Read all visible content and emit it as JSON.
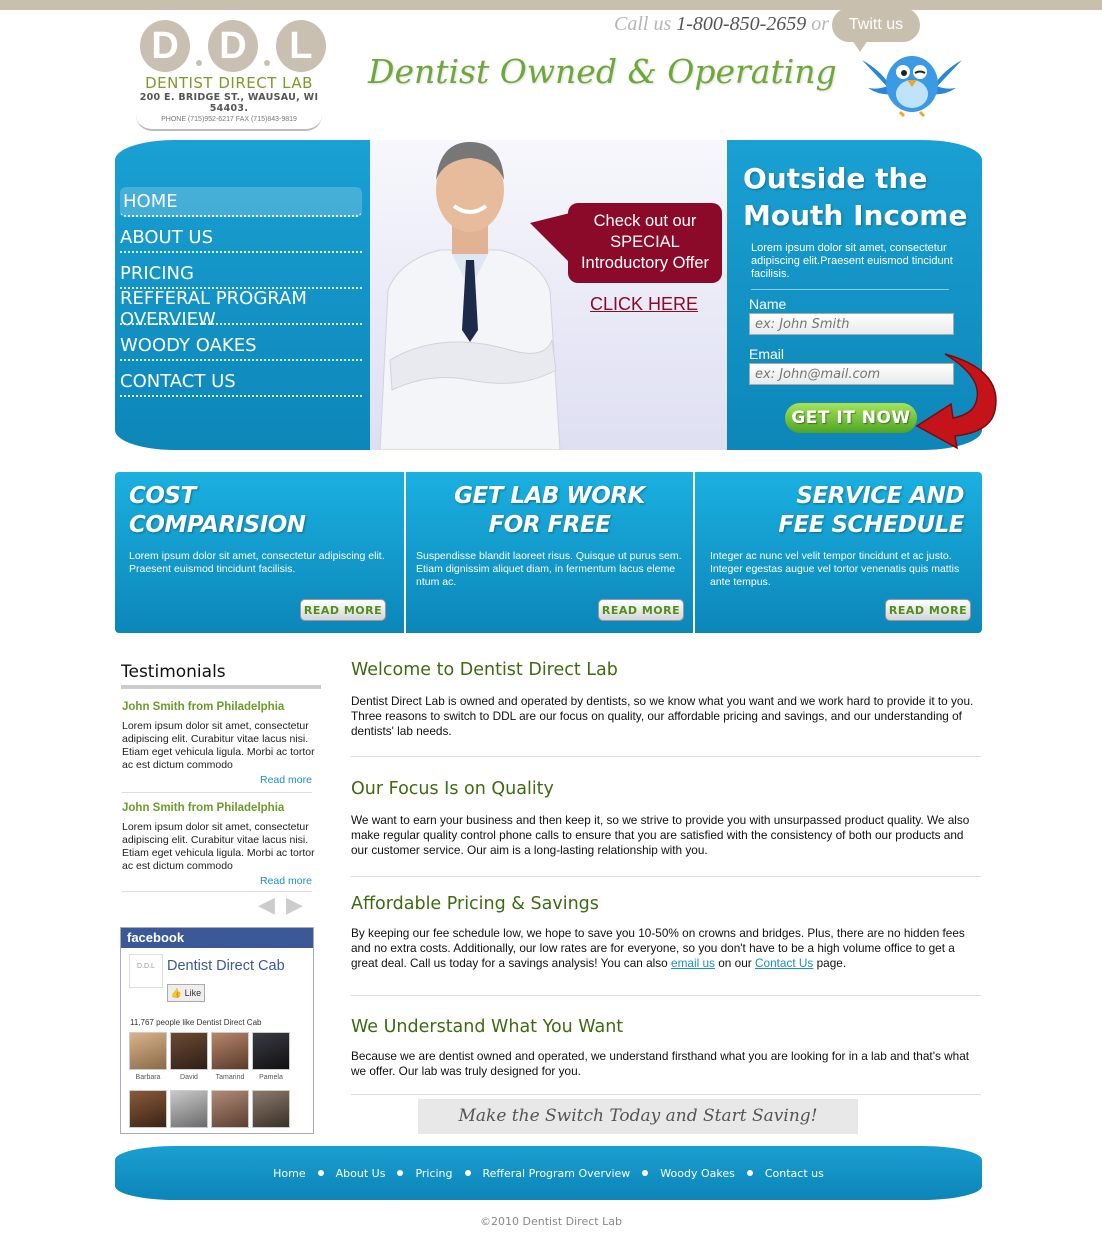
{
  "logo": {
    "letters": [
      "D",
      "D",
      "L"
    ],
    "name": "DENTIST DIRECT LAB",
    "address": "200 E. BRIDGE ST., WAUSAU, WI 54403.",
    "phone": "PHONE (715)952-6217   FAX (715)843-9819"
  },
  "header": {
    "tagline": "Dentist Owned & Operating",
    "call_prefix": "Call us",
    "call_number": "1-800-850-2659",
    "call_suffix": "or",
    "twit_label": "Twitt us"
  },
  "nav": {
    "items": [
      {
        "label": "HOME",
        "active": true
      },
      {
        "label": "ABOUT US"
      },
      {
        "label": "PRICING"
      },
      {
        "label": "REFFERAL PROGRAM OVERVIEW"
      },
      {
        "label": "WOODY OAKES"
      },
      {
        "label": "CONTACT US"
      }
    ]
  },
  "promo": {
    "bubble_line1": "Check out our",
    "bubble_line2": "SPECIAL",
    "bubble_line3": "Introductory Offer",
    "click_here": "CLICK HERE"
  },
  "signup": {
    "title_line1": "Outside the",
    "title_line2": "Mouth Income",
    "text": "Lorem ipsum dolor sit amet, consectetur adipiscing elit.Praesent euismod tincidunt facilisis.",
    "name_label": "Name",
    "name_placeholder": "ex: John Smith",
    "email_label": "Email",
    "email_placeholder": "ex: John@mail.com",
    "button": "GET IT NOW"
  },
  "features": [
    {
      "title_line1": "COST",
      "title_line2": "COMPARISION",
      "text": "Lorem ipsum dolor sit amet, consectetur adipiscing elit. Praesent euismod tincidunt facilisis.",
      "button": "READ MORE"
    },
    {
      "title_line1": "GET LAB WORK",
      "title_line2": "FOR FREE",
      "text": "Suspendisse blandit laoreet risus. Quisque ut purus sem. Etiam dignissim aliquet diam, in fermentum lacus eleme ntum ac.",
      "button": "READ MORE"
    },
    {
      "title_line1": "SERVICE AND",
      "title_line2": "FEE SCHEDULE",
      "text": "Integer ac nunc vel velit tempor tincidunt et ac justo. Integer egestas augue vel tortor venenatis quis mattis ante tempus.",
      "button": "READ MORE"
    }
  ],
  "testimonials": {
    "title": "Testimonials",
    "items": [
      {
        "name": "John Smith from Philadelphia",
        "text": "Lorem ipsum dolor sit amet, consectetur adipiscing elit. Curabitur vitae lacus nisi. Etiam eget vehicula ligula. Morbi ac tortor ac est dictum commodo",
        "more": "Read more"
      },
      {
        "name": "John Smith from Philadelphia",
        "text": "Lorem ipsum dolor sit amet, consectetur adipiscing elit. Curabitur vitae lacus nisi. Etiam eget vehicula ligula. Morbi ac tortor ac est dictum commodo",
        "more": "Read more"
      }
    ]
  },
  "facebook": {
    "header": "facebook",
    "logo_text": "D.D.L",
    "page_name": "Dentist Direct Cab",
    "like": "Like",
    "count_text": "11,767 people like Dentist Direct Cab",
    "fans": [
      "Barbara",
      "David",
      "Tamarind",
      "Pamela"
    ]
  },
  "content": {
    "sections": [
      {
        "title": "Welcome to Dentist Direct Lab",
        "body": "Dentist Direct Lab is owned and operated by dentists, so we know what you want and we work hard to provide it to you. Three reasons to switch to DDL are our focus on quality, our affordable pricing and savings, and our understanding of dentists' lab needs."
      },
      {
        "title": "Our Focus Is on Quality",
        "body": "We want to earn your business and then keep it, so we strive to provide you with unsurpassed product quality. We also make regular quality control phone calls to ensure that you are satisfied with the consistency of both our products and our customer service. Our aim is a long-lasting relationship with you."
      },
      {
        "title": "Affordable Pricing & Savings",
        "body_start": "By keeping our fee schedule low, we hope to save you 10-50% on crowns and bridges. Plus, there are no hidden fees and no extra costs. Additionally, our low rates are for everyone, so you don't have to be a high volume office to get a great deal. Call us today for a savings analysis! You can also ",
        "link1": "email us",
        "body_mid": " on our ",
        "link2": "Contact Us",
        "body_end": " page."
      },
      {
        "title": "We Understand What You Want",
        "body": "Because we are dentist owned and operated, we understand firsthand what you are looking for in a lab and that's what we offer. Our lab was truly designed for you."
      }
    ],
    "cta": "Make the Switch Today and Start Saving!"
  },
  "footer": {
    "links": [
      "Home",
      "About Us",
      "Pricing",
      "Refferal Program Overview",
      "Woody Oakes",
      "Contact us"
    ],
    "copyright": "©2010 Dentist Direct Lab"
  }
}
